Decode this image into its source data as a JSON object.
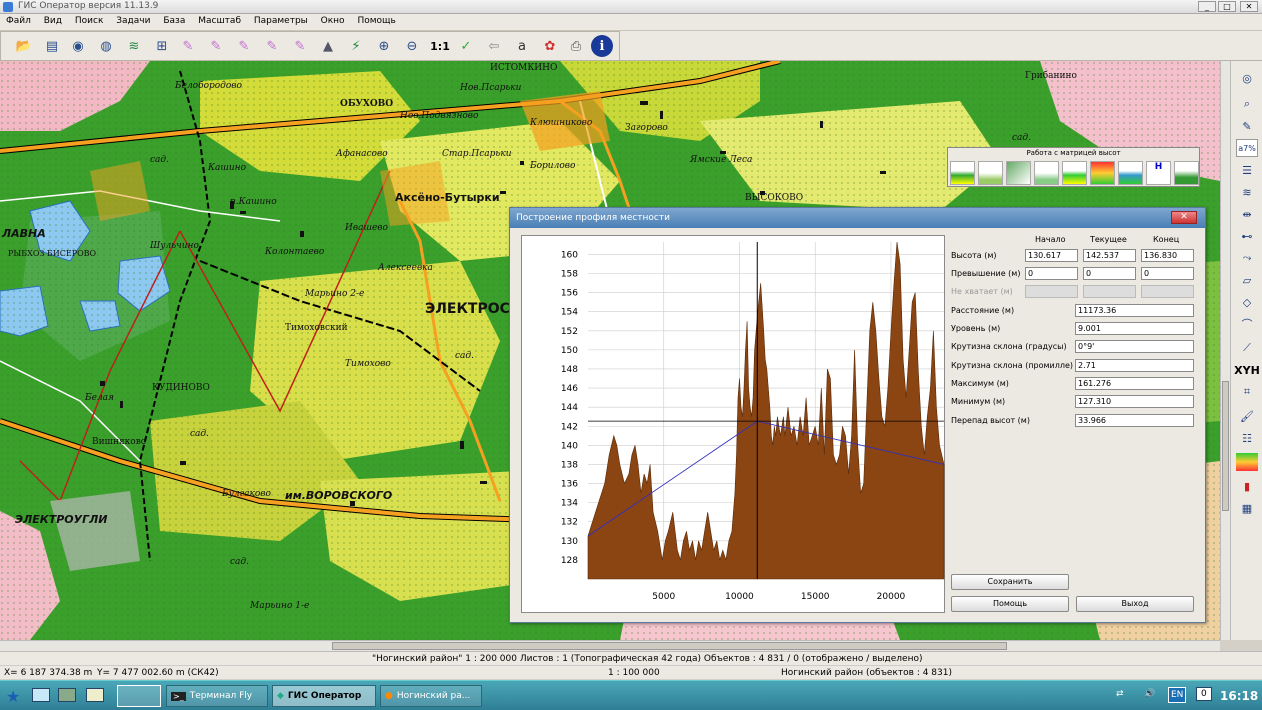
{
  "window": {
    "title": "ГИС Оператор версия 11.13.9"
  },
  "menu": [
    "Файл",
    "Вид",
    "Поиск",
    "Задачи",
    "База",
    "Масштаб",
    "Параметры",
    "Окно",
    "Помощь"
  ],
  "toolbar": {
    "scale_button": "1:1"
  },
  "map_labels": {
    "belobrodovo": "Белобородово",
    "obukhovo": "ОБУХОВО",
    "nov_podvyazno": "Нов.Подвязново",
    "nov_psarki": "Нов.Псарьки",
    "klyushnikovo": "Клюшниково",
    "zagorovo": "Загорово",
    "yamskie": "Ямские Леса",
    "vysokovo": "ВЫСОКОВО",
    "gribanino": "Грибанино",
    "borilovo": "Борилово",
    "star_psarki": "Стар.Псарьки",
    "afanasovo": "Афанасово",
    "kashino": "Кашино",
    "p_kashino": "п.Кашино",
    "aksyono": "Аксёно-Бутырки",
    "ivashevo": "Ивашево",
    "kolontaevo": "Колонтаево",
    "alekseevka": "Алексеевка",
    "marino": "Марьино 2-е",
    "shalyachino": "Шульчино",
    "lavna": "ЛАВНА",
    "ryb_biserovo": "РЫБХОЗ БИСЕРОВО",
    "timokhovo": "Тимоховский",
    "zimokhovo": "Тимохово",
    "elektrostal": "ЭЛЕКТРОС",
    "belaya": "Белая",
    "kudinovo": "КУДИНОВО",
    "vishnyakovo": "Вишняково",
    "elektrougli": "ЭЛЕКТРОУГЛИ",
    "bulgakovo": "Булгаково",
    "vorovskogo": "им.ВОРОВСКОГО",
    "maryino1": "Марьино 1-е",
    "sad": "сад.",
    "istomkino": "ИСТОМКИНО"
  },
  "matrix_toolbar": {
    "title": "Работа с матрицей высот"
  },
  "dialog": {
    "title": "Построение профиля местности",
    "col_start": "Начало",
    "col_current": "Текущее",
    "col_end": "Конец",
    "rows": [
      {
        "label": "Высота (м)",
        "start": "130.617",
        "current": "142.537",
        "end": "136.830"
      },
      {
        "label": "Превышение (м)",
        "start": "0",
        "current": "0",
        "end": "0"
      },
      {
        "label": "Не хватает (м)",
        "start": "",
        "current": "",
        "end": "",
        "disabled": true
      }
    ],
    "single": [
      {
        "label": "Расстояние (м)",
        "value": "11173.36"
      },
      {
        "label": "Уровень (м)",
        "value": "9.001"
      },
      {
        "label": "Крутизна склона (градусы)",
        "value": "0°9'"
      },
      {
        "label": "Крутизна склона (промилле)",
        "value": "2.71"
      },
      {
        "label": "Максимум (м)",
        "value": "161.276"
      },
      {
        "label": "Минимум (м)",
        "value": "127.310"
      },
      {
        "label": "Перепад высот (м)",
        "value": "33.966"
      }
    ],
    "save": "Сохранить",
    "help": "Помощь",
    "exit": "Выход"
  },
  "chart_data": {
    "type": "area",
    "xlabel": "",
    "ylabel": "",
    "xlim": [
      0,
      23500
    ],
    "ylim": [
      126,
      161.3
    ],
    "x_ticks": [
      5000,
      10000,
      15000,
      20000
    ],
    "y_ticks": [
      128,
      130,
      132,
      134,
      136,
      138,
      140,
      142,
      144,
      146,
      148,
      150,
      152,
      154,
      156,
      158,
      160
    ],
    "crosshair": {
      "x": 11173,
      "y": 142.537
    },
    "series": [
      {
        "color": "#8b4513",
        "x": [
          0,
          300,
          700,
          1100,
          1400,
          1700,
          1900,
          2100,
          2400,
          2700,
          2900,
          3100,
          3300,
          3500,
          3700,
          3900,
          4100,
          4300,
          4600,
          4900,
          5100,
          5300,
          5600,
          5900,
          6100,
          6300,
          6500,
          6700,
          6900,
          7100,
          7300,
          7500,
          7700,
          7900,
          8100,
          8300,
          8500,
          8700,
          8900,
          9100,
          9300,
          9500,
          9700,
          9800,
          9900,
          10000,
          10100,
          10200,
          10300,
          10400,
          10500,
          10600,
          10700,
          10800,
          10900,
          11000,
          11200,
          11400,
          11600,
          11700,
          11800,
          11900,
          12000,
          12100,
          12200,
          12300,
          12400,
          12500,
          12600,
          12700,
          12800,
          12900,
          13000,
          13200,
          13400,
          13600,
          13800,
          14000,
          14200,
          14400,
          14600,
          14800,
          15000,
          15200,
          15400,
          15600,
          15800,
          16000,
          16200,
          16400,
          16600,
          16800,
          17000,
          17200,
          17400,
          17600,
          17800,
          18000,
          18200,
          18400,
          18600,
          18800,
          19000,
          19200,
          19400,
          19600,
          19800,
          20000,
          20200,
          20400,
          20600,
          20800,
          21000,
          21200,
          21400,
          21600,
          21800,
          22000,
          22200,
          22400,
          22600,
          22800,
          23000,
          23200,
          23500
        ],
        "y": [
          130.5,
          132,
          134,
          136,
          139,
          141,
          140,
          138,
          136,
          137,
          139,
          140,
          138,
          135,
          137,
          136,
          138,
          133,
          131,
          128,
          130,
          131,
          133,
          129,
          128,
          130,
          131,
          129,
          130,
          128,
          130,
          129,
          131,
          133,
          131,
          129,
          130,
          128,
          129,
          128,
          130,
          131,
          135,
          139,
          145,
          147,
          144,
          143,
          146,
          150,
          153,
          146,
          144,
          143,
          145,
          150,
          154,
          157,
          152,
          149,
          148,
          146,
          144,
          141,
          140,
          142,
          141,
          143,
          142,
          141,
          142,
          143,
          141,
          144,
          141,
          142,
          140,
          143,
          141,
          145,
          140,
          141,
          142,
          140,
          146,
          139,
          148,
          147,
          139,
          138,
          139,
          142,
          141,
          137,
          141,
          150,
          140,
          135,
          136,
          144,
          152,
          155,
          152,
          147,
          143,
          142,
          146,
          152,
          157,
          161.3,
          159,
          149,
          145,
          150,
          155,
          156,
          148,
          142,
          139,
          143,
          146,
          152,
          144,
          140,
          138
        ]
      }
    ]
  }
}
